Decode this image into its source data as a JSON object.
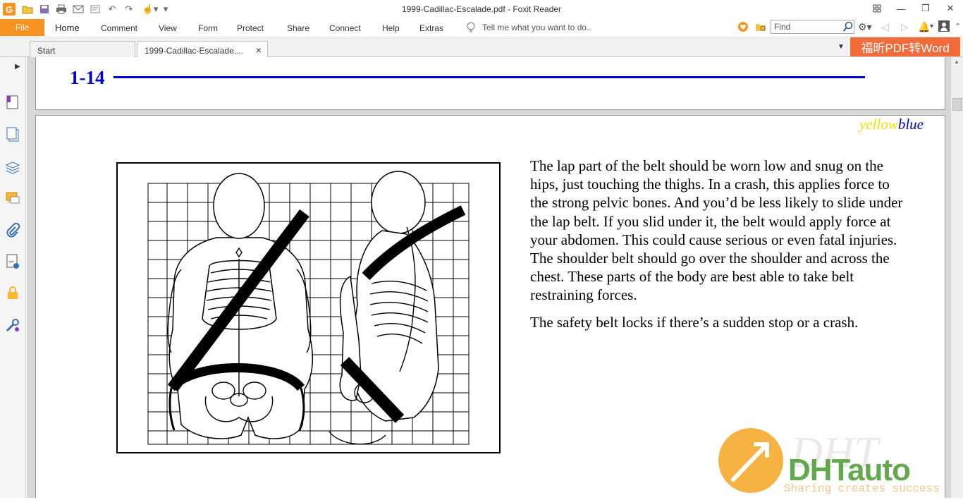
{
  "window": {
    "title": "1999-Cadillac-Escalade.pdf - Foxit Reader"
  },
  "quick_access": {
    "icons": [
      "foxit-logo-icon",
      "open-icon",
      "save-icon",
      "print-icon",
      "email-icon",
      "undo-icon",
      "redo-icon",
      "hand-tool-icon",
      "customize-icon"
    ]
  },
  "ribbon": {
    "file_label": "File",
    "tabs": [
      "Home",
      "Comment",
      "View",
      "Form",
      "Protect",
      "Share",
      "Connect",
      "Help",
      "Extras"
    ],
    "tell_me_placeholder": "Tell me what you want to do..",
    "find_placeholder": "Find"
  },
  "doc_tabs": {
    "start_label": "Start",
    "active_label": "1999-Cadillac-Escalade....",
    "close_glyph": "×"
  },
  "promo": {
    "label": "福昕PDF转Word",
    "color": "#f26b3a"
  },
  "left_panel": {
    "icons": [
      "bookmarks-icon",
      "pages-icon",
      "layers-icon",
      "comments-icon",
      "attachments-icon",
      "signatures-icon",
      "security-icon",
      "tools-icon"
    ]
  },
  "document": {
    "page_number": "1-14",
    "color_label_yellow": "yellow",
    "color_label_blue": "blue",
    "paragraph1": "The lap part of the belt should be worn low and snug on the hips, just touching the thighs. In a crash, this applies force to the strong pelvic bones. And you’d be less likely to slide under the lap belt. If you slid under it, the belt would apply force at your abdomen. This could cause serious or even fatal injuries. The shoulder belt should go over the shoulder and across the chest. These parts of the body are best able to take belt restraining forces.",
    "paragraph2": "The safety belt locks if there’s a sudden stop or a crash.",
    "accent_blue": "#0000d0",
    "accent_yellow": "#f0e000"
  },
  "watermark": {
    "brand": "DHTauto",
    "tagline": "Sharing creates success"
  }
}
